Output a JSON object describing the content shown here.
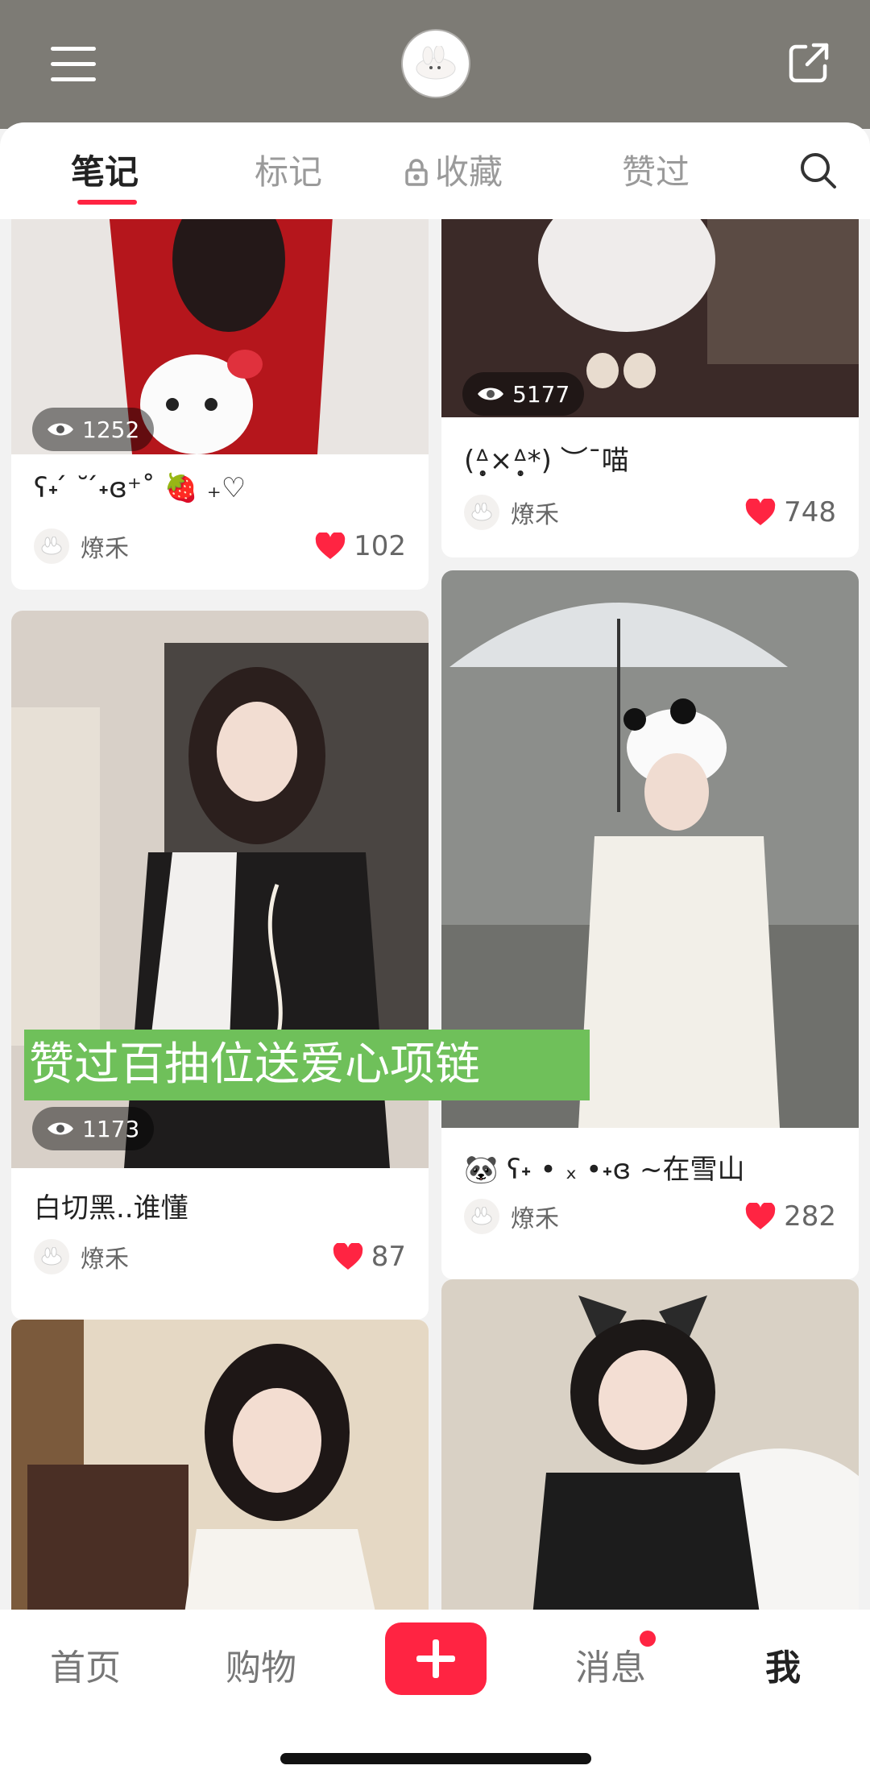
{
  "tabs": [
    {
      "label": "笔记"
    },
    {
      "label": "标记"
    },
    {
      "label": "收藏"
    },
    {
      "label": "赞过"
    }
  ],
  "posts": [
    {
      "views": "1252",
      "title": "ʕ˖ ́ ˘ ́˖ɞ⁺˚ 🍓 ₊♡",
      "author": "燎禾",
      "likes": "102",
      "colors": [
        "#b5161c",
        "#e8e3de"
      ]
    },
    {
      "views": "5177",
      "title": "(ᐞ̩̩̥×ᐞ̩̩̥*) ︶ˉ喵",
      "author": "燎禾",
      "likes": "748",
      "colors": [
        "#3b2a28",
        "#d9d3cc"
      ]
    },
    {
      "views": "1173",
      "title": "白切黑..谁懂",
      "author": "燎禾",
      "likes": "87",
      "banner": "赞过百抽位送爱心项链",
      "colors": [
        "#2a2625",
        "#d8d0c8"
      ]
    },
    {
      "title": "🐼 ʕ˖ • ₓ •˖ɞ ~在雪山",
      "author": "燎禾",
      "likes": "282",
      "colors": [
        "#8c8e8b",
        "#f2efe8"
      ]
    },
    {
      "colors": [
        "#7b5a3c",
        "#e5d8c4"
      ]
    },
    {
      "colors": [
        "#2a2a2a",
        "#d9d1c5"
      ]
    }
  ],
  "bottom_nav": {
    "home": "首页",
    "shop": "购物",
    "messages": "消息",
    "me": "我"
  },
  "colors": {
    "accent": "#ff2442",
    "topbar": "#7d7b75",
    "promo": "#6fc05a"
  }
}
